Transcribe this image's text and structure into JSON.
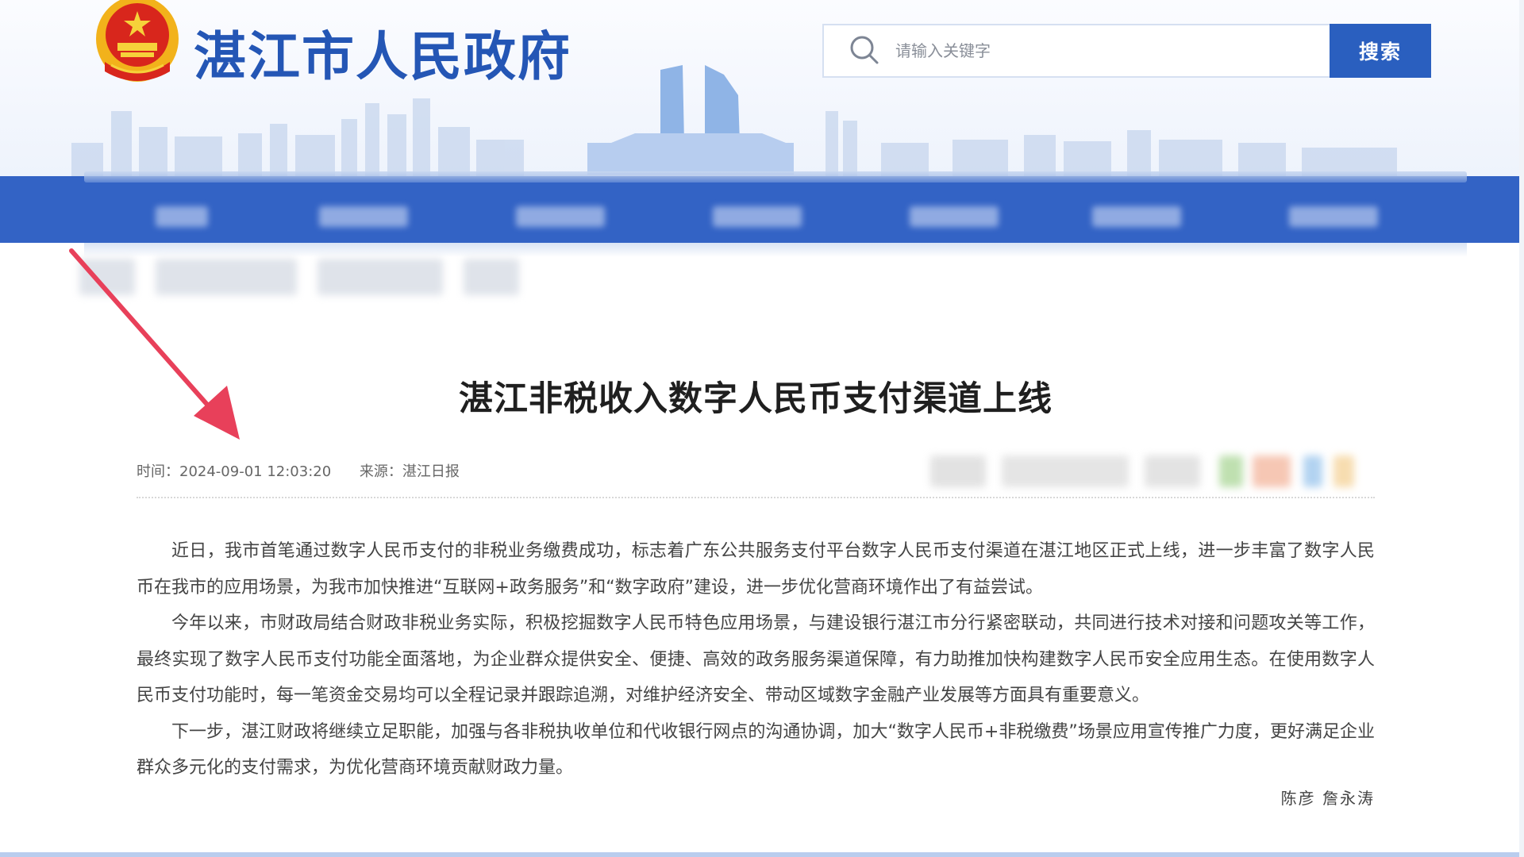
{
  "header": {
    "site_title": "湛江市人民政府",
    "emblem_icon": "national-emblem-icon",
    "search": {
      "placeholder": "请输入关键字",
      "button_label": "搜索",
      "icon": "search-icon"
    }
  },
  "colors": {
    "brand_blue": "#2456b5",
    "nav_blue": "#3363c5",
    "button_blue": "#2a5fbf",
    "arrow_red": "#e8405a"
  },
  "article": {
    "title": "湛江非税收入数字人民币支付渠道上线",
    "time_label": "时间：",
    "time_value": "2024-09-01 12:03:20",
    "source_label": "来源：",
    "source_value": "湛江日报",
    "paragraphs": [
      "近日，我市首笔通过数字人民币支付的非税业务缴费成功，标志着广东公共服务支付平台数字人民币支付渠道在湛江地区正式上线，进一步丰富了数字人民币在我市的应用场景，为我市加快推进“互联网+政务服务”和“数字政府”建设，进一步优化营商环境作出了有益尝试。",
      "今年以来，市财政局结合财政非税业务实际，积极挖掘数字人民币特色应用场景，与建设银行湛江市分行紧密联动，共同进行技术对接和问题攻关等工作，最终实现了数字人民币支付功能全面落地，为企业群众提供安全、便捷、高效的政务服务渠道保障，有力助推加快构建数字人民币安全应用生态。在使用数字人民币支付功能时，每一笔资金交易均可以全程记录并跟踪追溯，对维护经济安全、带动区域数字金融产业发展等方面具有重要意义。",
      "下一步，湛江财政将继续立足职能，加强与各非税执收单位和代收银行网点的沟通协调，加大“数字人民币+非税缴费”场景应用宣传推广力度，更好满足企业群众多元化的支付需求，为优化营商环境贡献财政力量。"
    ],
    "author": "陈彦 詹永涛"
  }
}
